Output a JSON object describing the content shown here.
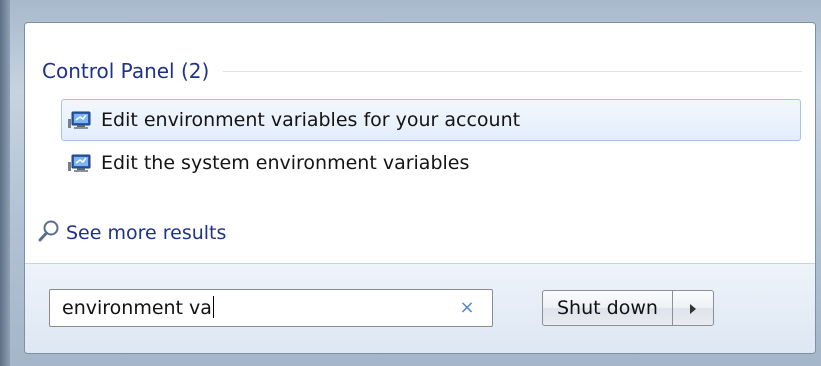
{
  "results": {
    "section_title": "Control Panel (2)",
    "items": [
      {
        "label": "Edit environment variables for your account",
        "icon": "control-panel-icon",
        "selected": true
      },
      {
        "label": "Edit the system environment variables",
        "icon": "control-panel-icon",
        "selected": false
      }
    ],
    "see_more": {
      "label": "See more results",
      "icon": "search-magnifier-icon"
    }
  },
  "footer": {
    "search": {
      "value": "environment va",
      "clear_icon": "×"
    },
    "shutdown_label": "Shut down",
    "shutdown_arrow_icon": "triangle-right-icon"
  },
  "colors": {
    "header_text": "#1e3287",
    "link_text": "#1e3287",
    "selection_bg": "#e3eefb",
    "selection_border": "#a7c4e6"
  }
}
